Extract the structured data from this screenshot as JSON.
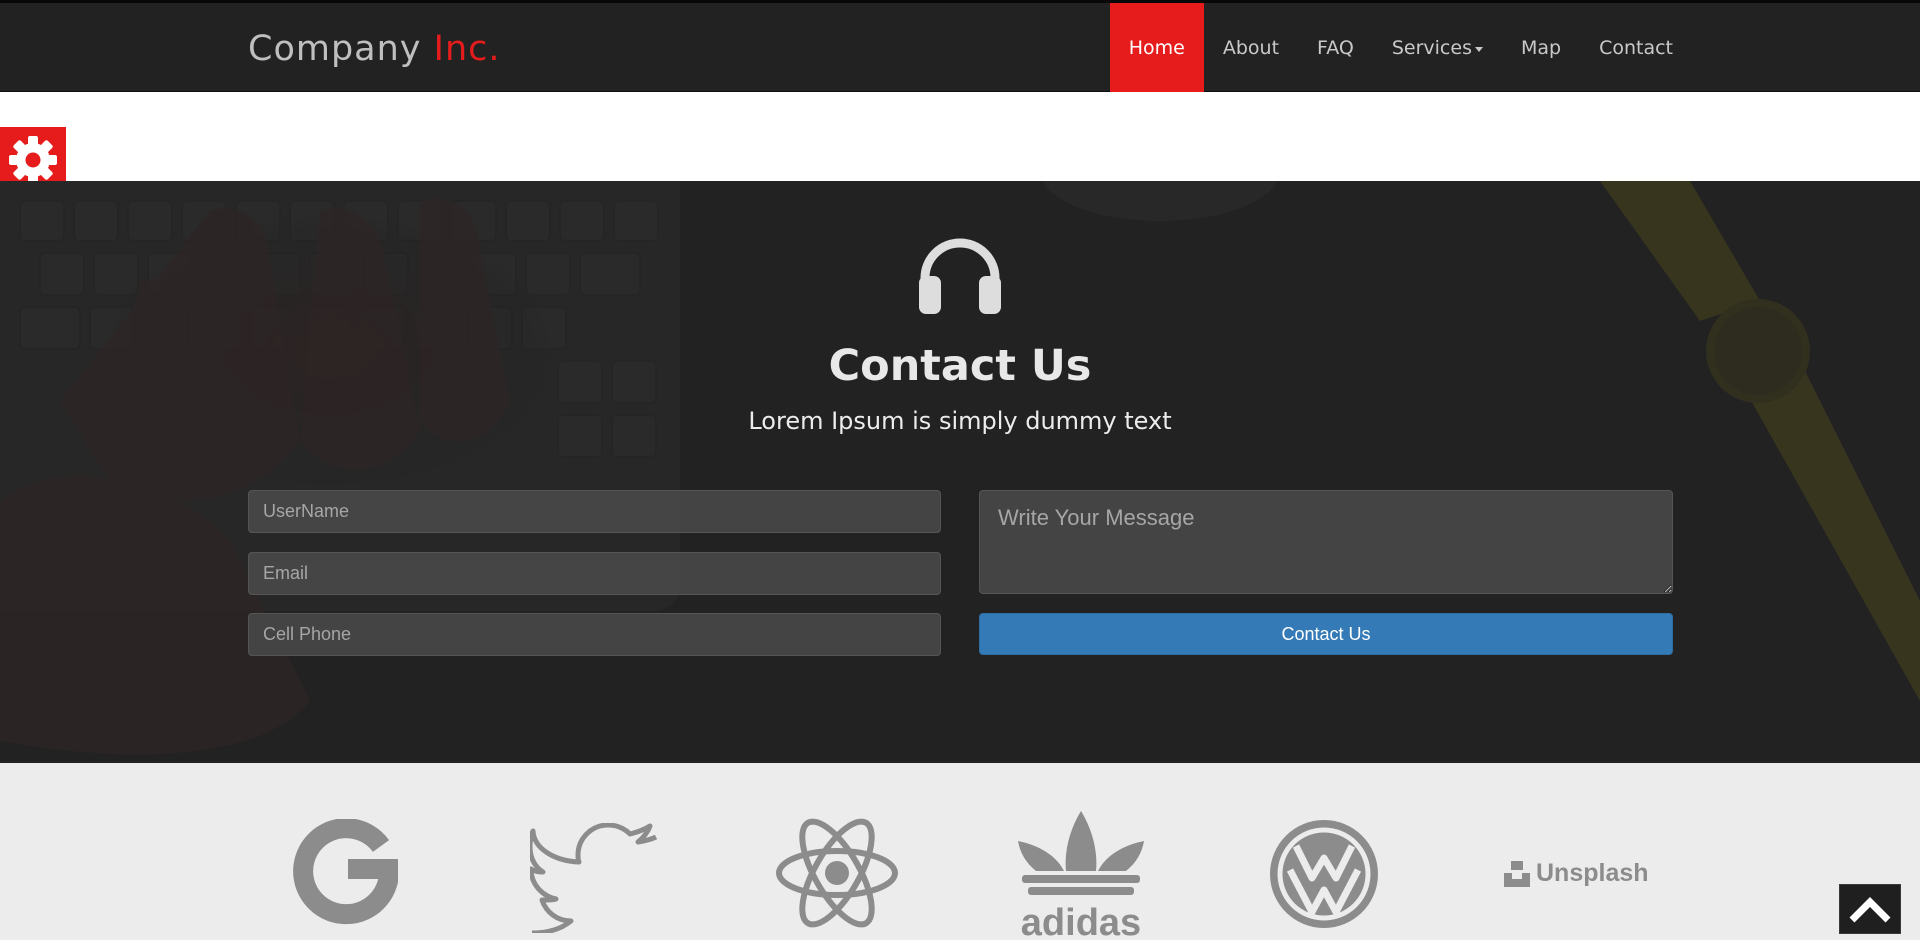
{
  "navbar": {
    "brand_main": "Company",
    "brand_accent": "Inc.",
    "items": [
      {
        "label": "Home"
      },
      {
        "label": "About"
      },
      {
        "label": "FAQ"
      },
      {
        "label": "Services"
      },
      {
        "label": "Map"
      },
      {
        "label": "Contact"
      }
    ],
    "active_item": "Home"
  },
  "settings": {
    "icon": "gear-icon"
  },
  "contact": {
    "icon": "headphones-icon",
    "title": "Contact Us",
    "subtitle": "Lorem Ipsum is simply dummy text",
    "fields": {
      "username_placeholder": "UserName",
      "email_placeholder": "Email",
      "phone_placeholder": "Cell Phone",
      "message_placeholder": "Write Your Message"
    },
    "submit_label": "Contact Us"
  },
  "brands": {
    "logos": [
      "google-logo",
      "twitter-logo",
      "react-logo",
      "adidas-logo",
      "volkswagen-logo",
      "unsplash-logo"
    ],
    "adidas_text": "adidas",
    "unsplash_text": "Unsplash"
  },
  "back_to_top": {
    "icon": "chevron-up-icon"
  },
  "colors": {
    "accent": "#e61c1c",
    "navbar_bg": "#222222",
    "button_blue": "#337ab7",
    "brands_bg": "#ececec",
    "logo_gray": "#8c8c8c"
  }
}
